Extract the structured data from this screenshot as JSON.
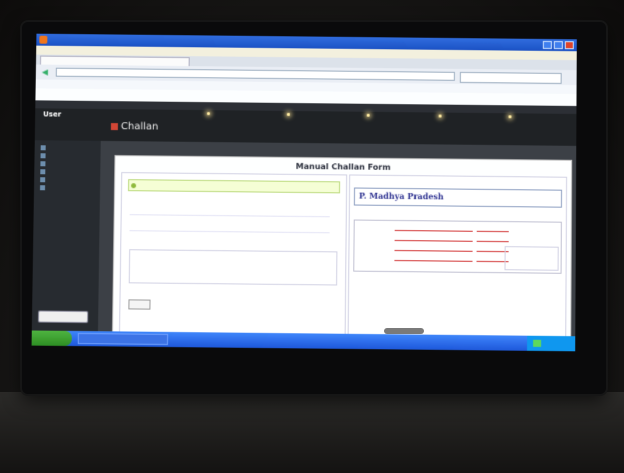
{
  "browser": {
    "title": "",
    "menu": [
      "",
      "",
      "",
      "",
      "",
      ""
    ],
    "tab_label": "",
    "url": "",
    "bookmarks": [
      "",
      "",
      ""
    ]
  },
  "site": {
    "header": "",
    "darkbar": ""
  },
  "app": {
    "user_label": "User",
    "page_heading": "Challan",
    "breadcrumb": "",
    "sidebar_items": [
      "",
      "",
      "",
      "",
      "",
      ""
    ],
    "sidebar_button": ""
  },
  "form": {
    "title": "Manual Challan Form",
    "notice": "",
    "fields": [
      "",
      "",
      ""
    ],
    "submit": ""
  },
  "invoice": {
    "brand": "P. Madhya Pradesh",
    "brand_sub": "",
    "address": "",
    "section": "",
    "rows": [
      {
        "label": "",
        "value": "",
        "value2": ""
      },
      {
        "label": "",
        "value": "",
        "value2": ""
      },
      {
        "label": "",
        "value": "",
        "value2": ""
      },
      {
        "label": "",
        "value": "",
        "value2": ""
      }
    ],
    "note": ""
  },
  "taskbar": {
    "start_label": "",
    "task_item": ""
  }
}
